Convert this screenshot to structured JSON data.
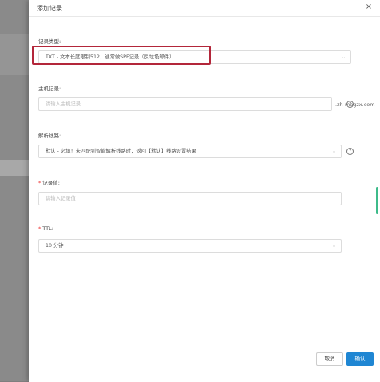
{
  "panel": {
    "title": "添加记录",
    "close": "×"
  },
  "record_type": {
    "label": "记录类型:",
    "value": "TXT - 文本长度限制512，通常做SPF记录（反垃圾邮件）"
  },
  "host_record": {
    "label": "主机记录:",
    "placeholder": "请输入主机记录",
    "suffix": ".zh-mogzx.com"
  },
  "line": {
    "label": "解析线路:",
    "value": "默认 - 必填！未匹配到智能解析线路时，返回【默认】线路设置结果"
  },
  "record_value": {
    "label": "记录值:",
    "placeholder": "请输入记录值"
  },
  "ttl": {
    "label": "TTL:",
    "value": "10 分钟"
  },
  "footer": {
    "cancel": "取消",
    "ok": "确认"
  },
  "help_icon": "?",
  "colors": {
    "primary": "#1f86d3",
    "highlight": "#b3263a",
    "required": "#e33333",
    "scroll": "#3dbb8a"
  }
}
